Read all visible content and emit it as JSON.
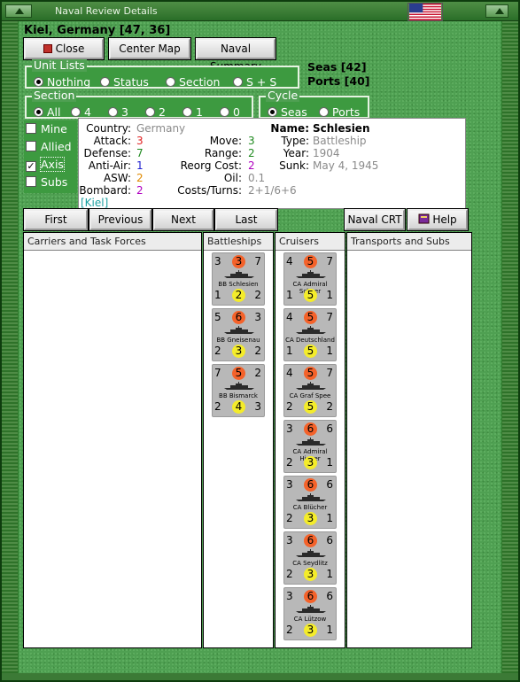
{
  "window": {
    "title": "Naval Review Details"
  },
  "location": "Kiel, Germany [47, 36]",
  "top_buttons": {
    "close": "Close",
    "center_map": "Center Map",
    "naval_summary": "Naval Summary"
  },
  "unit_lists": {
    "legend": "Unit Lists",
    "options": [
      "Nothing",
      "Status",
      "Section",
      "S + S"
    ],
    "selected": "Nothing"
  },
  "counts": {
    "seas": "Seas [42]",
    "ports": "Ports [40]"
  },
  "section": {
    "legend": "Section",
    "options": [
      "All",
      "4",
      "3",
      "2",
      "1",
      "0"
    ],
    "selected": "All"
  },
  "cycle": {
    "legend": "Cycle",
    "options": [
      "Seas",
      "Ports"
    ],
    "selected": "Seas"
  },
  "filters": [
    {
      "label": "Mine",
      "checked": false
    },
    {
      "label": "Allied",
      "checked": false
    },
    {
      "label": "Axis",
      "checked": true
    },
    {
      "label": "Subs",
      "checked": false
    }
  ],
  "check_mark": "✓",
  "info": {
    "country_label": "Country:",
    "country": "Germany",
    "attack_label": "Attack:",
    "attack": "3",
    "defense_label": "Defense:",
    "defense": "7",
    "antiair_label": "Anti-Air:",
    "antiair": "1",
    "asw_label": "ASW:",
    "asw": "2",
    "bombard_label": "Bombard:",
    "bombard": "2",
    "home": "[Kiel]",
    "move_label": "Move:",
    "move": "3",
    "range_label": "Range:",
    "range": "2",
    "reorg_label": "Reorg Cost:",
    "reorg": "2",
    "oil_label": "Oil:",
    "oil": "0.1",
    "costs_label": "Costs/Turns:",
    "costs": "2+1/6+6",
    "name_label": "Name:",
    "name": "Schlesien",
    "type_label": "Type:",
    "type": "Battleship",
    "year_label": "Year:",
    "year": "1904",
    "sunk_label": "Sunk:",
    "sunk": "May 4, 1945"
  },
  "nav": {
    "first": "First",
    "previous": "Previous",
    "next": "Next",
    "last": "Last",
    "crt": "Naval CRT",
    "help": "Help"
  },
  "columns": [
    "Carriers and Task Forces",
    "Battleships",
    "Cruisers",
    "Transports and Subs"
  ],
  "battleships": [
    {
      "name": "BB Schlesien",
      "tl": "3",
      "tm": "3",
      "tr": "7",
      "bl": "1",
      "bm": "2",
      "br": "2"
    },
    {
      "name": "BB Gneisenau",
      "tl": "5",
      "tm": "6",
      "tr": "3",
      "bl": "2",
      "bm": "3",
      "br": "2"
    },
    {
      "name": "BB Bismarck",
      "tl": "7",
      "tm": "5",
      "tr": "2",
      "bl": "2",
      "bm": "4",
      "br": "3"
    }
  ],
  "cruisers": [
    {
      "name": "CA Admiral Scheer",
      "tl": "4",
      "tm": "5",
      "tr": "7",
      "bl": "1",
      "bm": "5",
      "br": "1"
    },
    {
      "name": "CA Deutschland",
      "tl": "4",
      "tm": "5",
      "tr": "7",
      "bl": "1",
      "bm": "5",
      "br": "1"
    },
    {
      "name": "CA Graf Spee",
      "tl": "4",
      "tm": "5",
      "tr": "7",
      "bl": "2",
      "bm": "5",
      "br": "2"
    },
    {
      "name": "CA Admiral Hipper",
      "tl": "3",
      "tm": "6",
      "tr": "6",
      "bl": "2",
      "bm": "3",
      "br": "1"
    },
    {
      "name": "CA Blücher",
      "tl": "3",
      "tm": "6",
      "tr": "6",
      "bl": "2",
      "bm": "3",
      "br": "1"
    },
    {
      "name": "CA Seydlitz",
      "tl": "3",
      "tm": "6",
      "tr": "6",
      "bl": "2",
      "bm": "3",
      "br": "1"
    },
    {
      "name": "CA Lützow",
      "tl": "3",
      "tm": "6",
      "tr": "6",
      "bl": "2",
      "bm": "3",
      "br": "1"
    }
  ],
  "colors": {
    "attack": "#e02020",
    "defense": "#1f8a1f",
    "antiair": "#2020d0",
    "asw": "#e08a00",
    "bombard": "#b000c0",
    "home": "#1aa0a0",
    "gray": "#8a8a8a"
  }
}
